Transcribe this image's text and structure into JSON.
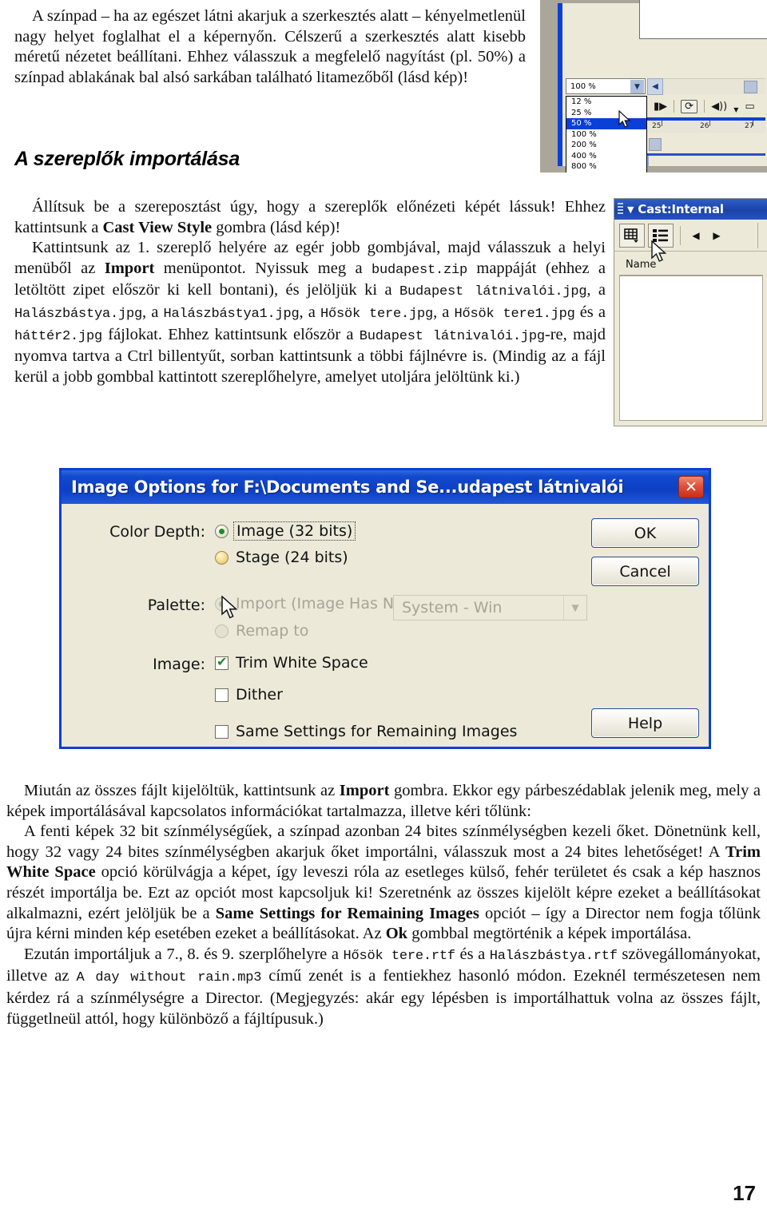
{
  "page": {
    "number": "17"
  },
  "top_paragraph": {
    "text": "A színpad – ha az egészet látni akarjuk a szerkesztés alatt – kényelmetlenül nagy helyet foglalhat el a képernyőn. Célszerű a szerkesztés alatt kisebb méretű nézetet beállítani. Ehhez válasszuk a megfelelő nagyítást (pl. 50%) a színpad ablakának bal alsó sarkában található litamezőből (lásd kép)!"
  },
  "heading": {
    "text": "A szereplők importálása"
  },
  "mid_paragraphs": {
    "p1_a": "Állítsuk be a szereposztást úgy, hogy a szereplők előnézeti képét lássuk! Ehhez kattintsunk a ",
    "p1_b": "Cast View Style",
    "p1_c": " gombra (lásd kép)!",
    "p2_a": "Kattintsunk az 1. szereplő helyére az egér jobb gombjával, majd válasszuk a helyi menüből az ",
    "p2_b": "Import",
    "p2_c": " menüpontot. Nyissuk meg a ",
    "p2_m1": "budapest.zip",
    "p2_d": " mappáját (ehhez a letöltött zipet először ki kell bontani), és jelöljük ki a ",
    "p2_m2": "Budapest látnivalói.jpg",
    "p2_e": ", a ",
    "p2_m3": "Halászbástya.jpg",
    "p2_f": ", a ",
    "p2_m4": "Halászbástya1.jpg",
    "p2_g": ", a ",
    "p2_m5": "Hősök tere.jpg",
    "p2_h": ", a ",
    "p2_m6": "Hősök tere1.jpg",
    "p2_i": " és a ",
    "p2_m7": "háttér2.jpg",
    "p2_j": " fájlokat. Ehhez kattintsunk először a ",
    "p2_m8": "Budapest látnivalói.jpg",
    "p2_k": "-re, majd nyomva tartva a Ctrl billentyűt, sorban kattintsunk a többi fájlnévre is. (Mindig az a fájl kerül a jobb gombbal kattintott szereplőhelyre, amelyet utoljára jelöltünk ki.)"
  },
  "bottom_paragraphs": {
    "p1_a": "Miután az összes fájlt kijelöltük, kattintsunk az ",
    "p1_b": "Import",
    "p1_c": " gombra. Ekkor egy párbeszédablak jelenik meg, mely a képek importálásával kapcsolatos információkat tartalmazza, illetve kéri tőlünk:",
    "p2_a": "A fenti képek 32 bit színmélységűek, a színpad azonban 24 bites színmélységben kezeli őket. Dönetnünk kell, hogy 32 vagy 24 bites színmélységben akarjuk őket importálni, válasszuk most a 24 bites lehetőséget! A ",
    "p2_b": "Trim White Space",
    "p2_c": " opció körülvágja a képet, így leveszi róla az esetleges külső, fehér területet és csak a kép hasznos részét importálja be. Ezt az opciót most kapcsoljuk ki! Szeretnénk az összes kijelölt képre ezeket a beállításokat alkalmazni, ezért jelöljük be a ",
    "p2_d": "Same Settings for Remaining Images",
    "p2_e": " opciót – így a Director nem fogja tőlünk újra kérni minden kép esetében ezeket a beállításokat. Az ",
    "p2_f": "Ok",
    "p2_g": " gombbal megtörténik a képek importálása.",
    "p3_a": "Ezután importáljuk a 7., 8. és 9. szerplőhelyre a ",
    "p3_m1": "Hősök tere.rtf",
    "p3_b": " és a ",
    "p3_m2": "Halászbástya.rtf",
    "p3_c": " szövegállományokat, illetve az ",
    "p3_m3": "A day without rain.mp3",
    "p3_d": " című zenét is a fentiekhez hasonló módon. Ezeknél természetesen nem kérdez rá a színmélységre a Director. (Megjegyzés: akár egy lépésben is importálhattuk volna az összes fájlt, függetlneül attól, hogy különböző a fájltípusuk.)"
  },
  "screenshot_zoom": {
    "combo_value": "100 %",
    "options": [
      "12 %",
      "25 %",
      "50 %",
      "100 %",
      "200 %",
      "400 %",
      "800 %"
    ],
    "selected_option": "50 %",
    "frames": [
      "25",
      "26",
      "27"
    ],
    "colors": {
      "selection": "#0a3fd8",
      "window_bg": "#ece9d8",
      "desktop": "#aaa69a"
    }
  },
  "screenshot_cast": {
    "title": "Cast:Internal",
    "column_header": "Name",
    "colors": {
      "titlebar": "#1b43a8",
      "panel": "#ece9d8"
    }
  },
  "dialog": {
    "title": "Image Options for F:\\Documents and Se...udapest látnivalói",
    "close_label": "✕",
    "labels": {
      "color_depth": "Color Depth:",
      "palette": "Palette:",
      "image": "Image:"
    },
    "color_depth_options": [
      {
        "label": "Image (32 bits)",
        "selected": true
      },
      {
        "label": "Stage (24 bits)",
        "selected": false
      }
    ],
    "palette_options": [
      {
        "label": "Import (Image Has No Palette)",
        "selected": true,
        "disabled": true
      },
      {
        "label": "Remap to",
        "selected": false,
        "disabled": true
      }
    ],
    "palette_select_value": "System - Win",
    "image_checkboxes": [
      {
        "label": "Trim White Space",
        "checked": true
      },
      {
        "label": "Dither",
        "checked": false
      },
      {
        "label": "Same Settings for Remaining Images",
        "checked": false
      }
    ],
    "buttons": [
      "OK",
      "Cancel",
      "Help"
    ],
    "colors": {
      "titlebar": "#0c3fc3",
      "body": "#ece9d8",
      "close": "#c92d18"
    }
  }
}
